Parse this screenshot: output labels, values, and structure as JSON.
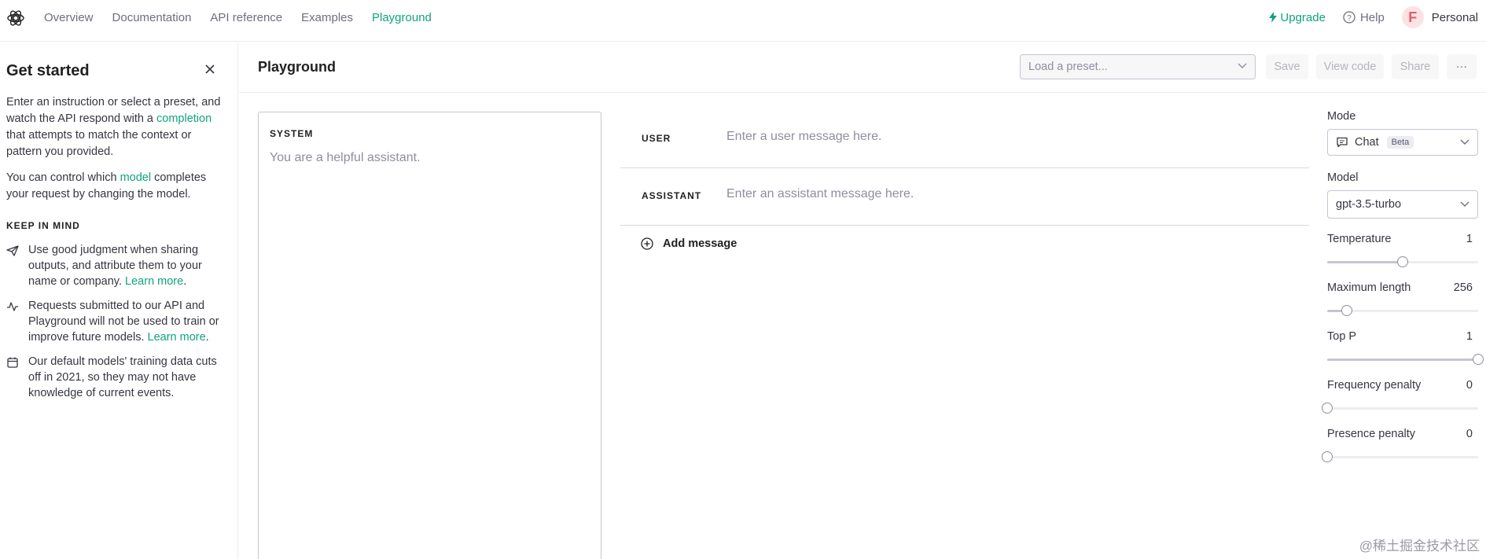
{
  "nav": {
    "links": [
      "Overview",
      "Documentation",
      "API reference",
      "Examples",
      "Playground"
    ],
    "active": "Playground",
    "upgrade": "Upgrade",
    "help": "Help",
    "avatar_letter": "F",
    "account": "Personal"
  },
  "sidebar": {
    "title": "Get started",
    "p1_a": "Enter an instruction or select a preset, and watch the API respond with a ",
    "p1_link": "completion",
    "p1_b": " that attempts to match the context or pattern you provided.",
    "p2_a": "You can control which ",
    "p2_link": "model",
    "p2_b": " completes your request by changing the model.",
    "keep_in_mind": "KEEP IN MIND",
    "tip1": "Use good judgment when sharing outputs, and attribute them to your name or company. ",
    "tip2": "Requests submitted to our API and Playground will not be used to train or improve future models. ",
    "tip3": "Our default models' training data cuts off in 2021, so they may not have knowledge of current events.",
    "learn_more": "Learn more",
    "period": "."
  },
  "header": {
    "title": "Playground",
    "preset_placeholder": "Load a preset...",
    "save": "Save",
    "view_code": "View code",
    "share": "Share",
    "more": "···"
  },
  "system": {
    "label": "SYSTEM",
    "placeholder": "You are a helpful assistant."
  },
  "messages": [
    {
      "role": "USER",
      "placeholder": "Enter a user message here."
    },
    {
      "role": "ASSISTANT",
      "placeholder": "Enter an assistant message here."
    }
  ],
  "add_message": "Add message",
  "settings": {
    "mode_label": "Mode",
    "mode_value": "Chat",
    "mode_badge": "Beta",
    "model_label": "Model",
    "model_value": "gpt-3.5-turbo",
    "sliders": [
      {
        "label": "Temperature",
        "value": "1",
        "fraction": 0.5
      },
      {
        "label": "Maximum length",
        "value": "256",
        "fraction": 0.13
      },
      {
        "label": "Top P",
        "value": "1",
        "fraction": 1.0
      },
      {
        "label": "Frequency penalty",
        "value": "0",
        "fraction": 0.0
      },
      {
        "label": "Presence penalty",
        "value": "0",
        "fraction": 0.0
      }
    ]
  },
  "watermark": "@稀土掘金技术社区",
  "colors": {
    "accent": "#10a37f",
    "text": "#353740",
    "muted": "#8e8ea0",
    "border": "#c5c5d2"
  }
}
